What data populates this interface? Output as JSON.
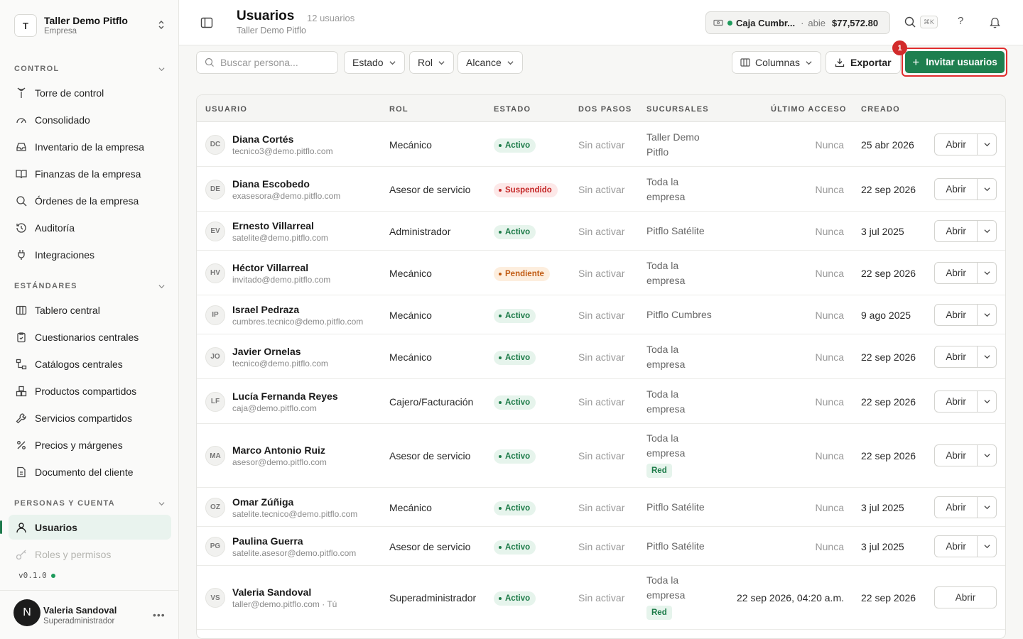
{
  "workspace": {
    "initial": "T",
    "name": "Taller Demo Pitflo",
    "type": "Empresa"
  },
  "sidebar": {
    "sections": [
      {
        "title": "CONTROL",
        "items": [
          {
            "label": "Torre de control",
            "icon": "tower-icon"
          },
          {
            "label": "Consolidado",
            "icon": "gauge-icon"
          },
          {
            "label": "Inventario de la empresa",
            "icon": "inbox-icon"
          },
          {
            "label": "Finanzas de la empresa",
            "icon": "book-icon"
          },
          {
            "label": "Órdenes de la empresa",
            "icon": "search-icon"
          },
          {
            "label": "Auditoría",
            "icon": "history-icon"
          },
          {
            "label": "Integraciones",
            "icon": "plug-icon"
          }
        ]
      },
      {
        "title": "ESTÁNDARES",
        "items": [
          {
            "label": "Tablero central",
            "icon": "columns-icon"
          },
          {
            "label": "Cuestionarios centrales",
            "icon": "clipboard-icon"
          },
          {
            "label": "Catálogos centrales",
            "icon": "tree-icon"
          },
          {
            "label": "Productos compartidos",
            "icon": "boxes-icon"
          },
          {
            "label": "Servicios compartidos",
            "icon": "wrench-icon"
          },
          {
            "label": "Precios y márgenes",
            "icon": "percent-icon"
          },
          {
            "label": "Documento del cliente",
            "icon": "document-icon"
          }
        ]
      },
      {
        "title": "PERSONAS Y CUENTA",
        "items": [
          {
            "label": "Usuarios",
            "icon": "user-icon"
          },
          {
            "label": "Roles y permisos",
            "icon": "key-icon"
          }
        ]
      }
    ],
    "version": "v0.1.0",
    "current_user": {
      "initial": "N",
      "name": "Valeria Sandoval",
      "role": "Superadministrador"
    }
  },
  "header": {
    "title": "Usuarios",
    "count": "12 usuarios",
    "subtitle": "Taller Demo Pitflo",
    "cash": {
      "name": "Caja Cumbr...",
      "separator": "·",
      "status": "abie",
      "amount": "$77,572.80"
    },
    "shortcut": "⌘K",
    "help": "?"
  },
  "toolbar": {
    "search_placeholder": "Buscar persona...",
    "filters": [
      "Estado",
      "Rol",
      "Alcance"
    ],
    "columns_label": "Columnas",
    "export_label": "Exportar",
    "invite_label": "Invitar usuarios",
    "step_badge": "1"
  },
  "table": {
    "headers": [
      "USUARIO",
      "ROL",
      "ESTADO",
      "DOS PASOS",
      "SUCURSALES",
      "ÚLTIMO ACCESO",
      "CREADO"
    ],
    "open_label": "Abrir",
    "rows": [
      {
        "initials": "DC",
        "name": "Diana Cortés",
        "email": "tecnico3@demo.pitflo.com",
        "role": "Mecánico",
        "status": "Activo",
        "status_type": "activo",
        "twofa": "Sin activar",
        "branch1": "Taller Demo",
        "branch2": "Pitflo",
        "tag": "",
        "last": "Nunca",
        "created": "25 abr 2026"
      },
      {
        "initials": "DE",
        "name": "Diana Escobedo",
        "email": "exasesora@demo.pitflo.com",
        "role": "Asesor de servicio",
        "status": "Suspendido",
        "status_type": "susp",
        "twofa": "Sin activar",
        "branch1": "Toda la",
        "branch2": "empresa",
        "tag": "",
        "last": "Nunca",
        "created": "22 sep 2026"
      },
      {
        "initials": "EV",
        "name": "Ernesto Villarreal",
        "email": "satelite@demo.pitflo.com",
        "role": "Administrador",
        "status": "Activo",
        "status_type": "activo",
        "twofa": "Sin activar",
        "branch1": "Pitflo Satélite",
        "branch2": "",
        "tag": "",
        "last": "Nunca",
        "created": "3 jul 2025"
      },
      {
        "initials": "HV",
        "name": "Héctor Villarreal",
        "email": "invitado@demo.pitflo.com",
        "role": "Mecánico",
        "status": "Pendiente",
        "status_type": "pend",
        "twofa": "Sin activar",
        "branch1": "Toda la",
        "branch2": "empresa",
        "tag": "",
        "last": "Nunca",
        "created": "22 sep 2026"
      },
      {
        "initials": "IP",
        "name": "Israel Pedraza",
        "email": "cumbres.tecnico@demo.pitflo.com",
        "role": "Mecánico",
        "status": "Activo",
        "status_type": "activo",
        "twofa": "Sin activar",
        "branch1": "Pitflo Cumbres",
        "branch2": "",
        "tag": "",
        "last": "Nunca",
        "created": "9 ago 2025"
      },
      {
        "initials": "JO",
        "name": "Javier Ornelas",
        "email": "tecnico@demo.pitflo.com",
        "role": "Mecánico",
        "status": "Activo",
        "status_type": "activo",
        "twofa": "Sin activar",
        "branch1": "Toda la",
        "branch2": "empresa",
        "tag": "",
        "last": "Nunca",
        "created": "22 sep 2026"
      },
      {
        "initials": "LF",
        "name": "Lucía Fernanda Reyes",
        "email": "caja@demo.pitflo.com",
        "role": "Cajero/Facturación",
        "status": "Activo",
        "status_type": "activo",
        "twofa": "Sin activar",
        "branch1": "Toda la",
        "branch2": "empresa",
        "tag": "",
        "last": "Nunca",
        "created": "22 sep 2026"
      },
      {
        "initials": "MA",
        "name": "Marco Antonio Ruiz",
        "email": "asesor@demo.pitflo.com",
        "role": "Asesor de servicio",
        "status": "Activo",
        "status_type": "activo",
        "twofa": "Sin activar",
        "branch1": "Toda la",
        "branch2": "empresa",
        "tag": "Red",
        "last": "Nunca",
        "created": "22 sep 2026"
      },
      {
        "initials": "OZ",
        "name": "Omar Zúñiga",
        "email": "satelite.tecnico@demo.pitflo.com",
        "role": "Mecánico",
        "status": "Activo",
        "status_type": "activo",
        "twofa": "Sin activar",
        "branch1": "Pitflo Satélite",
        "branch2": "",
        "tag": "",
        "last": "Nunca",
        "created": "3 jul 2025"
      },
      {
        "initials": "PG",
        "name": "Paulina Guerra",
        "email": "satelite.asesor@demo.pitflo.com",
        "role": "Asesor de servicio",
        "status": "Activo",
        "status_type": "activo",
        "twofa": "Sin activar",
        "branch1": "Pitflo Satélite",
        "branch2": "",
        "tag": "",
        "last": "Nunca",
        "created": "3 jul 2025"
      },
      {
        "initials": "VS",
        "name": "Valeria Sandoval",
        "email": "taller@demo.pitflo.com · Tú",
        "role": "Superadministrador",
        "status": "Activo",
        "status_type": "activo",
        "twofa": "Sin activar",
        "branch1": "Toda la",
        "branch2": "empresa",
        "tag": "Red",
        "last": "22 sep 2026, 04:20 a.m.",
        "created": "22 sep 2026"
      }
    ]
  }
}
